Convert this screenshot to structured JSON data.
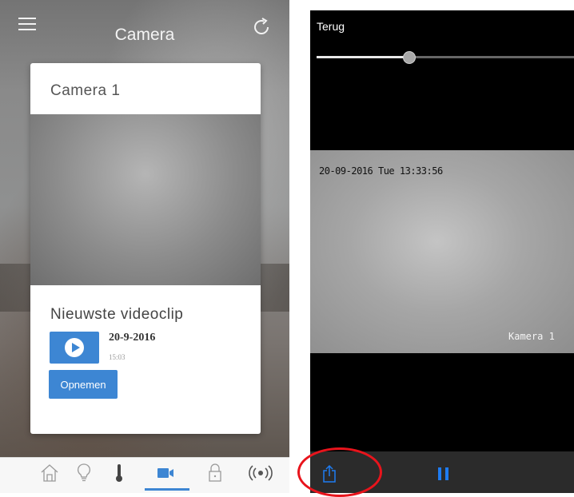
{
  "left_screen": {
    "title": "Camera",
    "card": {
      "camera_name": "Camera 1",
      "latest_clip": {
        "heading": "Nieuwste videoclip",
        "date": "20-9-2016",
        "time": "15:03"
      },
      "record_label": "Opnemen"
    },
    "tabs": [
      {
        "name": "home",
        "icon": "home-icon"
      },
      {
        "name": "lights",
        "icon": "lightbulb-icon"
      },
      {
        "name": "climate",
        "icon": "thermometer-icon"
      },
      {
        "name": "camera",
        "icon": "video-camera-icon",
        "active": true
      },
      {
        "name": "locks",
        "icon": "lock-icon"
      },
      {
        "name": "alarm",
        "icon": "broadcast-icon"
      }
    ]
  },
  "right_screen": {
    "back_label": "Terug",
    "playback_progress": 0.36,
    "osd_timestamp": "20-09-2016 Tue 13:33:56",
    "osd_camera_name": "Kamera 1"
  },
  "colors": {
    "accent": "#3d86d3",
    "playback_blue": "#1e7cf2",
    "annotation_red": "#e8141c"
  }
}
